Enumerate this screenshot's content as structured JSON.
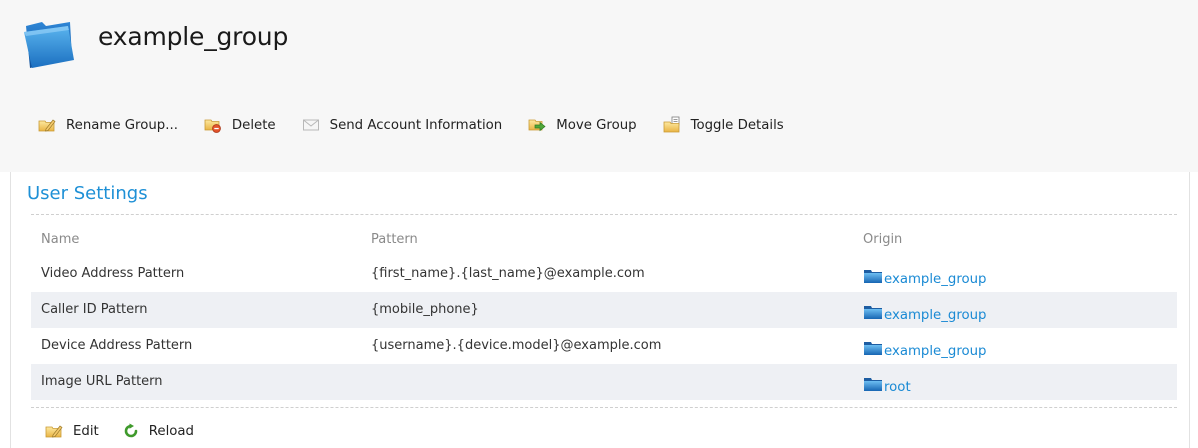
{
  "header": {
    "title": "example_group"
  },
  "toolbar": {
    "rename_label": "Rename Group...",
    "delete_label": "Delete",
    "send_label": "Send Account Information",
    "move_label": "Move Group",
    "toggle_label": "Toggle Details"
  },
  "settings": {
    "title": "User Settings",
    "columns": [
      "Name",
      "Pattern",
      "Origin"
    ],
    "rows": [
      {
        "name": "Video Address Pattern",
        "pattern": "{first_name}.{last_name}@example.com",
        "origin": "example_group"
      },
      {
        "name": "Caller ID Pattern",
        "pattern": "{mobile_phone}",
        "origin": "example_group"
      },
      {
        "name": "Device Address Pattern",
        "pattern": "{username}.{device.model}@example.com",
        "origin": "example_group"
      },
      {
        "name": "Image URL Pattern",
        "pattern": "",
        "origin": "root"
      }
    ]
  },
  "actions": {
    "edit_label": "Edit",
    "reload_label": "Reload"
  },
  "colors": {
    "accent": "#1e90d6",
    "link": "#1a8ad4",
    "row_alt": "#eef0f4",
    "header_bg": "#f7f7f7"
  },
  "icons": {
    "title": "folder-icon",
    "rename": "folder-edit-icon",
    "delete": "folder-delete-icon",
    "send": "envelope-icon",
    "move": "folder-move-icon",
    "toggle": "folder-details-icon",
    "origin": "folder-icon",
    "edit": "folder-edit-icon",
    "reload": "reload-icon"
  }
}
